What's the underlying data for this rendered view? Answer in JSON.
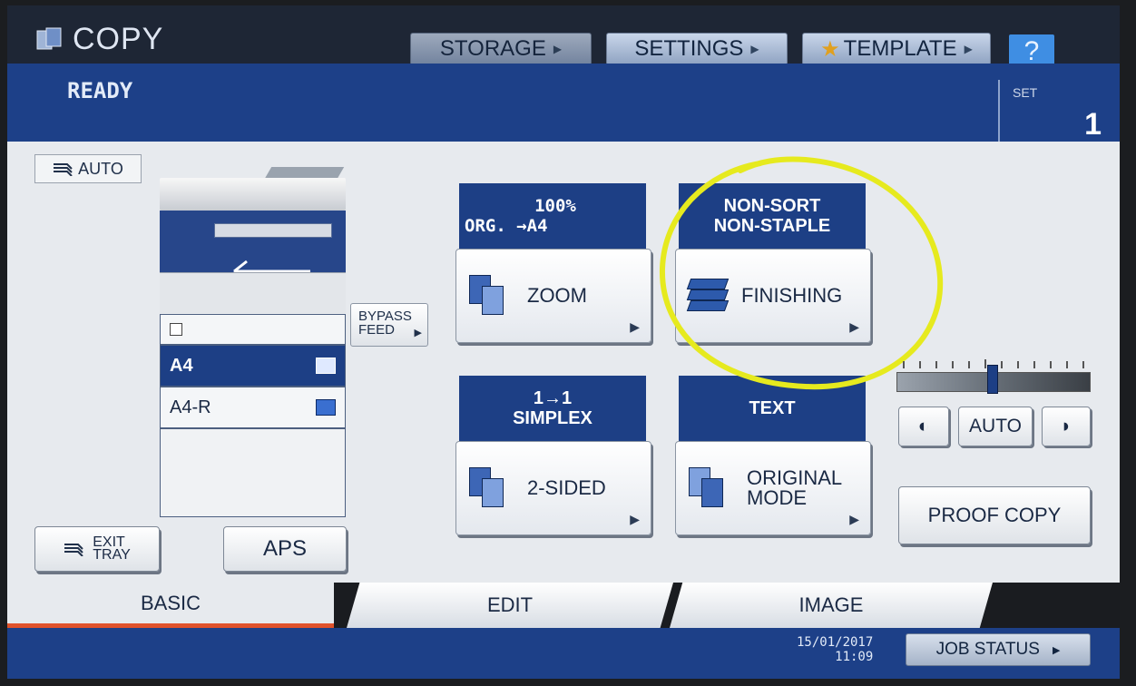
{
  "header": {
    "title": "COPY",
    "storage_label": "STORAGE",
    "settings_label": "SETTINGS",
    "template_label": "TEMPLATE",
    "help_label": "?"
  },
  "status": {
    "text": "READY",
    "set_label": "SET",
    "set_value": "1"
  },
  "paper": {
    "auto_label": "AUTO",
    "tray1_label": "",
    "trays": [
      {
        "label": "A4",
        "selected": true
      },
      {
        "label": "A4-R",
        "selected": false
      }
    ],
    "bypass_line1": "BYPASS",
    "bypass_line2": "FEED"
  },
  "functions": {
    "zoom": {
      "status_line1": "100%",
      "status_line2": "ORG. →A4",
      "label": "ZOOM"
    },
    "finishing": {
      "status_line1": "NON-SORT",
      "status_line2": "NON-STAPLE",
      "label": "FINISHING"
    },
    "duplex": {
      "status_line1": "1→1",
      "status_line2": "SIMPLEX",
      "label": "2-SIDED"
    },
    "original_mode": {
      "status_line1": "TEXT",
      "label_line1": "ORIGINAL",
      "label_line2": "MODE"
    }
  },
  "density": {
    "auto_label": "AUTO",
    "level": 0.5,
    "light_glyph": "◐",
    "dark_glyph": "◗"
  },
  "buttons": {
    "proof_copy": "PROOF COPY",
    "exit_tray_line1": "EXIT",
    "exit_tray_line2": "TRAY",
    "aps": "APS"
  },
  "tabs": [
    "BASIC",
    "EDIT",
    "IMAGE"
  ],
  "footer": {
    "date": "15/01/2017",
    "time": "11:09",
    "job_status": "JOB STATUS"
  },
  "colors": {
    "accent_blue": "#1d3f85",
    "highlight_ring": "#e6ea1e",
    "active_tab_underline": "#e0522b"
  }
}
